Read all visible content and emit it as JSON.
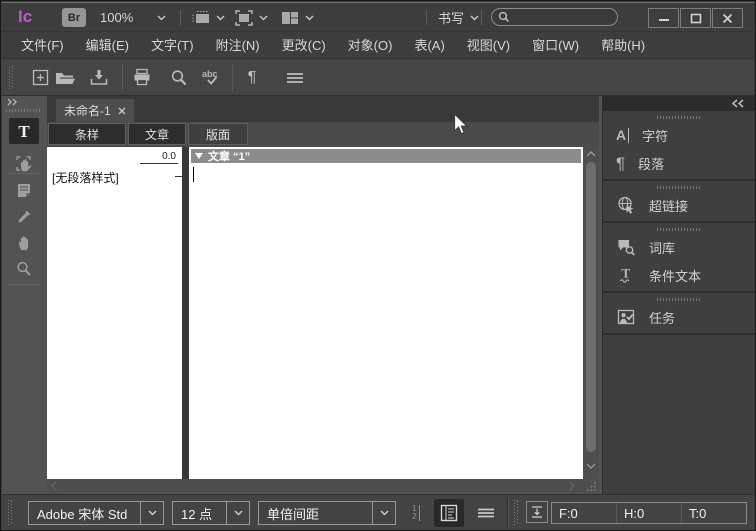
{
  "titlebar": {
    "logo": "Ic",
    "bridge_label": "Br",
    "zoom_level": "100%",
    "workspace_name": "书写",
    "search_value": ""
  },
  "menubar": {
    "items": [
      {
        "label": "文件(F)"
      },
      {
        "label": "编辑(E)"
      },
      {
        "label": "文字(T)"
      },
      {
        "label": "附注(N)"
      },
      {
        "label": "更改(C)"
      },
      {
        "label": "对象(O)"
      },
      {
        "label": "表(A)"
      },
      {
        "label": "视图(V)"
      },
      {
        "label": "窗口(W)"
      },
      {
        "label": "帮助(H)"
      }
    ]
  },
  "document": {
    "tab_title": "未命名-1",
    "view_tabs": [
      {
        "label": "条样",
        "active": true
      },
      {
        "label": "文章",
        "active": false
      },
      {
        "label": "版面",
        "active": false
      }
    ],
    "galley": {
      "depth_value": "0.0",
      "paragraph_style": "[无段落样式]"
    },
    "story_header": "文章 “1”"
  },
  "right_dock": {
    "panels": [
      {
        "label": "字符"
      },
      {
        "label": "段落"
      },
      {
        "label": "超链接"
      },
      {
        "label": "词库"
      },
      {
        "label": "条件文本"
      },
      {
        "label": "任务"
      }
    ]
  },
  "bottom_bar": {
    "font_family": "Adobe 宋体 Std",
    "font_size": "12 点",
    "leading": "单倍间距",
    "copyfit": {
      "f": "F:0",
      "h": "H:0",
      "t": "T:0"
    }
  },
  "icon_text": {
    "spellcheck": "abc",
    "paragraph_mark": "¶",
    "type_tool": "T",
    "character_a": "A",
    "conditional_t": "T",
    "line_one": "1",
    "line_two": "2"
  },
  "colors": {
    "logo_accent": "#b75fc6",
    "chrome_bg": "#3d3d3d",
    "workspace_bg": "#535353",
    "dock_bg": "#3f3f3f",
    "story_bar_bg": "#8c8c8c",
    "paper": "#ffffff"
  }
}
